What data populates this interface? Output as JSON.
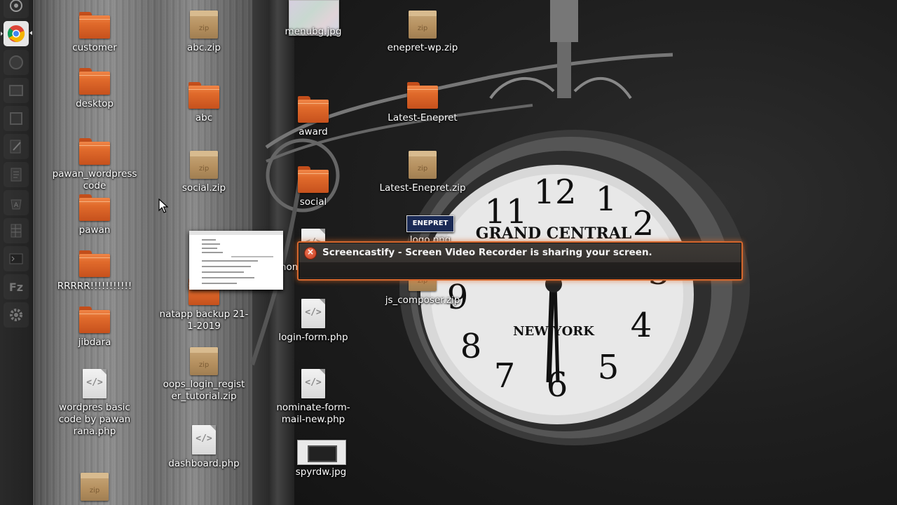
{
  "notification": {
    "message": "Screencastify - Screen Video Recorder is sharing your screen.",
    "close_glyph": "×"
  },
  "launcher": {
    "items": [
      {
        "name": "dash-home-icon"
      },
      {
        "name": "chrome-browser-icon"
      },
      {
        "name": "app-icon-1"
      },
      {
        "name": "app-icon-2"
      },
      {
        "name": "app-icon-3"
      },
      {
        "name": "text-editor-icon"
      },
      {
        "name": "document-icon"
      },
      {
        "name": "software-center-icon"
      },
      {
        "name": "spreadsheet-icon"
      },
      {
        "name": "terminal-icon"
      },
      {
        "name": "filezilla-icon"
      },
      {
        "name": "settings-icon"
      }
    ]
  },
  "logo_thumb_text": "ENEPRET",
  "desktop": {
    "col1": [
      {
        "label": "customer",
        "type": "folder"
      },
      {
        "label": "desktop",
        "type": "folder"
      },
      {
        "label": "pawan_wordpress code",
        "type": "folder"
      },
      {
        "label": "pawan",
        "type": "folder"
      },
      {
        "label": "RRRRR!!!!!!!!!!!",
        "type": "folder"
      },
      {
        "label": "jibdara",
        "type": "folder"
      },
      {
        "label": "wordpres basic code by pawan rana.php",
        "type": "php"
      },
      {
        "label": "",
        "type": "zip"
      }
    ],
    "col2": [
      {
        "label": "abc.zip",
        "type": "zip"
      },
      {
        "label": "abc",
        "type": "folder"
      },
      {
        "label": "social.zip",
        "type": "zip"
      },
      {
        "label": "natapp backup 21-1-2019",
        "type": "folder"
      },
      {
        "label": "oops_login_register_tutorial.zip",
        "type": "zip"
      },
      {
        "label": "dashboard.php",
        "type": "php"
      }
    ],
    "col3": [
      {
        "label": "menubg.jpg",
        "type": "image"
      },
      {
        "label": "award",
        "type": "folder"
      },
      {
        "label": "social",
        "type": "folder"
      },
      {
        "label": "nominate.php",
        "type": "php"
      },
      {
        "label": "login-form.php",
        "type": "php"
      },
      {
        "label": "nominate-form-mail-new.php",
        "type": "php"
      },
      {
        "label": "spyrdw.jpg",
        "type": "image"
      }
    ],
    "col4": [
      {
        "label": "enepret-wp.zip",
        "type": "zip"
      },
      {
        "label": "Latest-Enepret",
        "type": "folder"
      },
      {
        "label": "Latest-Enepret.zip",
        "type": "zip"
      },
      {
        "label": "logo.png",
        "type": "image"
      },
      {
        "label": "js_composer.zip",
        "type": "zip"
      }
    ]
  }
}
